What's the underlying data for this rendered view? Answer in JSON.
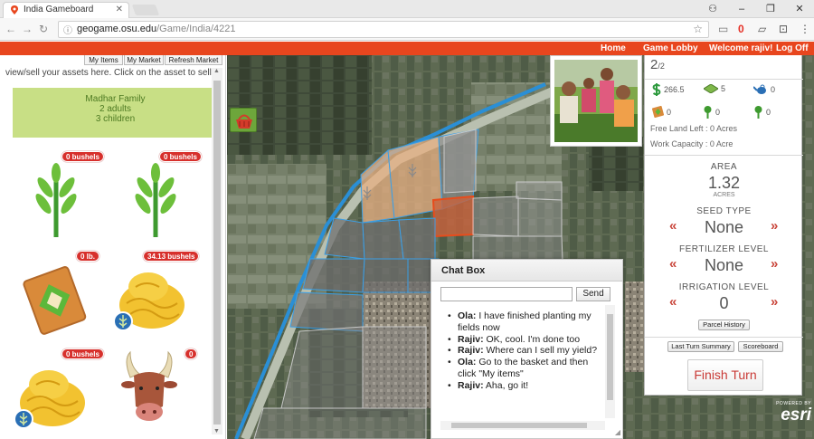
{
  "browser": {
    "tab_title": "India Gameboard",
    "url_host": "geogame.osu.edu",
    "url_path": "/Game/India/4221",
    "ext_badge": "0"
  },
  "topnav": {
    "home": "Home",
    "lobby": "Game Lobby",
    "welcome": "Welcome rajiv!",
    "logoff": "Log Off"
  },
  "left": {
    "tabs": [
      "My Items",
      "My Market",
      "Refresh Market"
    ],
    "info": "view/sell your assets here. Click on the asset to sell.",
    "family": {
      "name": "Madhar Family",
      "adults": "2 adults",
      "children": "3 children"
    },
    "assets": [
      {
        "name": "wheat-plant",
        "badge": "0 bushels"
      },
      {
        "name": "wheat-plant",
        "badge": "0 bushels"
      },
      {
        "name": "seed-sack",
        "badge": "0 lb."
      },
      {
        "name": "grain-pile",
        "badge": "34.13 bushels"
      },
      {
        "name": "grain-pile",
        "badge": "0 bushels"
      },
      {
        "name": "ox",
        "badge": "0"
      }
    ]
  },
  "right": {
    "turn": "2",
    "turn_total": "/2",
    "money": "266.5",
    "land": "5",
    "water": "0",
    "seed": "0",
    "crop_a": "0",
    "crop_b": "0",
    "free_land": "Free Land Left : 0 Acres",
    "work_capacity": "Work Capacity : 0 Acre",
    "area_label": "AREA",
    "area_value": "1.32",
    "area_unit": "ACRES",
    "seed_label": "SEED TYPE",
    "seed_value": "None",
    "fert_label": "FERTILIZER LEVEL",
    "fert_value": "None",
    "irr_label": "IRRIGATION LEVEL",
    "irr_value": "0",
    "arrow_left": "«",
    "arrow_right": "»",
    "parcel_history": "Parcel History",
    "last_turn": "Last Turn Summary",
    "scoreboard": "Scoreboard",
    "finish": "Finish Turn"
  },
  "chat": {
    "title": "Chat Box",
    "send": "Send",
    "messages": [
      {
        "user": "Ola:",
        "text": " I have finished planting my fields now"
      },
      {
        "user": "Rajiv:",
        "text": " OK, cool. I'm done too"
      },
      {
        "user": "Rajiv:",
        "text": " Where can I sell my yield?"
      },
      {
        "user": "Ola:",
        "text": " Go to the basket and then click \"My items\""
      },
      {
        "user": "Rajiv:",
        "text": " Aha, go it!"
      }
    ]
  },
  "esri": {
    "powered": "POWERED BY",
    "brand": "esri"
  },
  "colors": {
    "nav_orange": "#e8461e",
    "badge_red": "#d7302c",
    "family_green": "#c8df85",
    "arrow_red": "#c9453a",
    "parcel_blue": "#2a8fd6"
  }
}
